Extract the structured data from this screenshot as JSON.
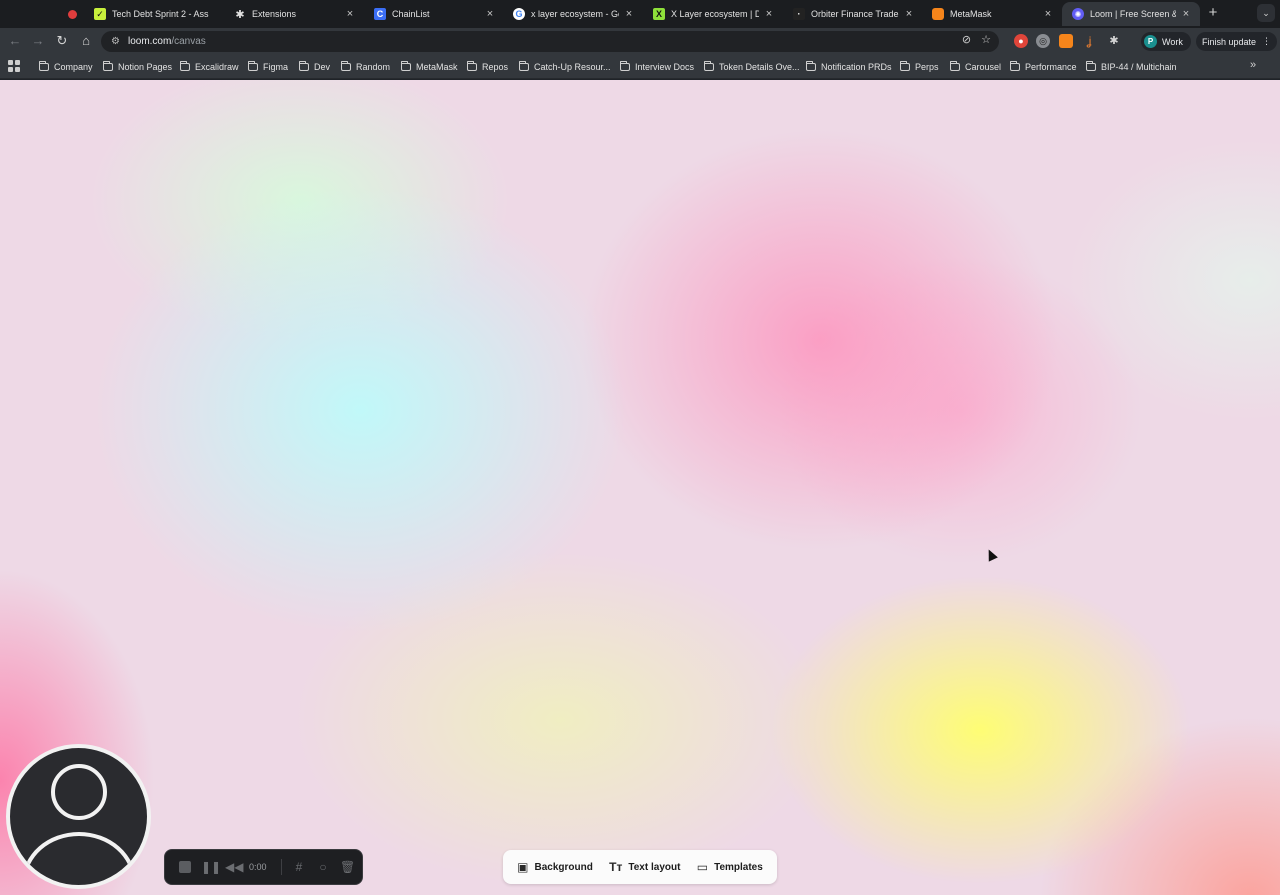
{
  "tabs": [
    {
      "title": "",
      "favicon": "record-icon",
      "color": "#e03d3d",
      "active": false
    },
    {
      "title": "Tech Debt Sprint 2 - Ass",
      "favicon": "asana-check-icon",
      "color": "#c8f03c",
      "active": false
    },
    {
      "title": "Extensions",
      "favicon": "puzzle-icon",
      "color": "#e3e3e3",
      "active": false
    },
    {
      "title": "ChainList",
      "favicon": "chainlist-icon",
      "color": "#3b6ef5",
      "active": false
    },
    {
      "title": "x layer ecosystem - Goo",
      "favicon": "google-icon",
      "color": "#ffffff",
      "active": false
    },
    {
      "title": "X Layer ecosystem | DAp",
      "favicon": "x-layer-icon",
      "color": "#8ee03a",
      "active": false
    },
    {
      "title": "Orbiter Finance Trade Et",
      "favicon": "orbiter-icon",
      "color": "#222222",
      "active": false
    },
    {
      "title": "MetaMask",
      "favicon": "metamask-fox-icon",
      "color": "#f6851b",
      "active": false
    },
    {
      "title": "Loom | Free Screen & Vi",
      "favicon": "loom-icon",
      "color": "#625df5",
      "active": true
    }
  ],
  "toolbar": {
    "url_host": "loom.com",
    "url_path": "/canvas",
    "profile_initial": "P",
    "profile_label": "Work",
    "finish_update_label": "Finish update"
  },
  "bookmarks": [
    "Company",
    "Notion Pages",
    "Excalidraw",
    "Figma",
    "Dev",
    "Random",
    "MetaMask",
    "Repos",
    "Catch-Up Resour...",
    "Interview Docs",
    "Token Details Ove...",
    "Notification PRDs",
    "Perps",
    "Carousel",
    "Performance",
    "BIP-44 / Multichain"
  ],
  "recorder": {
    "timer": "0:00"
  },
  "canvas_tools": {
    "background_label": "Background",
    "text_layout_label": "Text layout",
    "templates_label": "Templates"
  }
}
